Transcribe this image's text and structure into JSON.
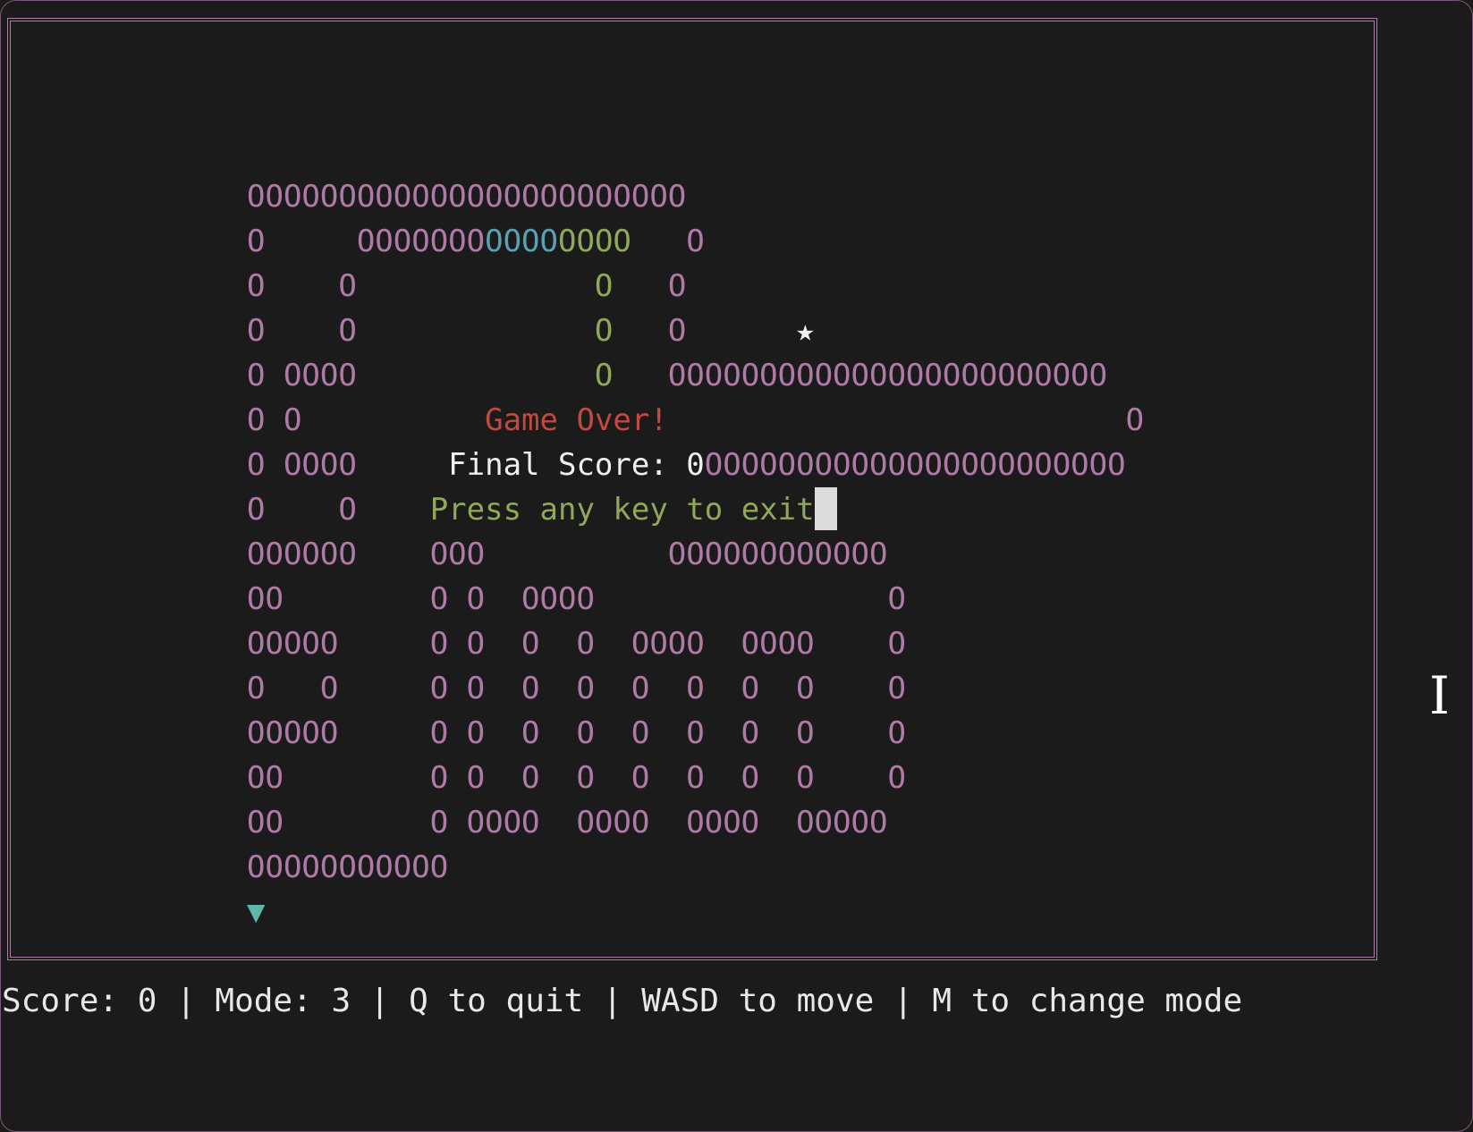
{
  "board": {
    "rows": [
      [
        {
          "t": "OOOOOOOOOOOOOOOOOOOOOOOO",
          "c": "pink"
        }
      ],
      [
        {
          "t": "O     OOOOOOO",
          "c": "pink"
        },
        {
          "t": "OOOO",
          "c": "blue"
        },
        {
          "t": "OOOO",
          "c": "green"
        },
        {
          "t": "   O",
          "c": "pink"
        }
      ],
      [
        {
          "t": "O    O",
          "c": "pink"
        },
        {
          "t": "             O",
          "c": "green"
        },
        {
          "t": "   O",
          "c": "pink"
        }
      ],
      [
        {
          "t": "O    O",
          "c": "pink"
        },
        {
          "t": "             O",
          "c": "green"
        },
        {
          "t": "   O",
          "c": "pink"
        },
        {
          "t": "      ★",
          "c": "white"
        }
      ],
      [
        {
          "t": "O OOOO",
          "c": "pink"
        },
        {
          "t": "             O",
          "c": "green"
        },
        {
          "t": "   OOOOOOOOOOOOOOOOOOOOOOOO",
          "c": "pink"
        }
      ],
      [
        {
          "t": "O O",
          "c": "pink"
        },
        {
          "t": "          Game Over!",
          "c": "red"
        },
        {
          "t": "                         O",
          "c": "pink"
        }
      ],
      [
        {
          "t": "O OOOO",
          "c": "pink"
        },
        {
          "t": "     Final Score: 0",
          "c": "white"
        },
        {
          "t": "OOOOOOOOOOOOOOOOOOOOOOO",
          "c": "pink"
        }
      ],
      [
        {
          "t": "O    O",
          "c": "pink"
        },
        {
          "t": "    Press any key to exit",
          "c": "green"
        },
        {
          "t": "",
          "c": "cursor"
        }
      ],
      [
        {
          "t": "OOOOOO    OOO          OOOOOOOOOOOO",
          "c": "pink"
        }
      ],
      [
        {
          "t": "OO        O O  OOOO                O",
          "c": "pink"
        }
      ],
      [
        {
          "t": "OOOOO     O O  O  O  OOOO  OOOO    O",
          "c": "pink"
        }
      ],
      [
        {
          "t": "O   O     O O  O  O  O  O  O  O    O",
          "c": "pink"
        }
      ],
      [
        {
          "t": "OOOOO     O O  O  O  O  O  O  O    O",
          "c": "pink"
        }
      ],
      [
        {
          "t": "OO        O O  O  O  O  O  O  O    O",
          "c": "pink"
        }
      ],
      [
        {
          "t": "OO        O OOOO  OOOO  OOOO  OOOOO",
          "c": "pink"
        }
      ],
      [
        {
          "t": "OOOOOOOOOOO",
          "c": "pink"
        }
      ],
      [
        {
          "t": "▼",
          "c": "teal"
        }
      ]
    ]
  },
  "status_bar": {
    "text": "Score: 0 | Mode: 3 | Q to quit | WASD to move | M to change mode"
  },
  "icons": {
    "text_cursor": "text-cursor-icon"
  },
  "colors": {
    "background": "#1b1b1b",
    "border": "#b07aa6",
    "wall": "#b07aa6",
    "snake_blue": "#5b9fb3",
    "snake_green": "#8fa85a",
    "game_over": "#c1493f"
  }
}
